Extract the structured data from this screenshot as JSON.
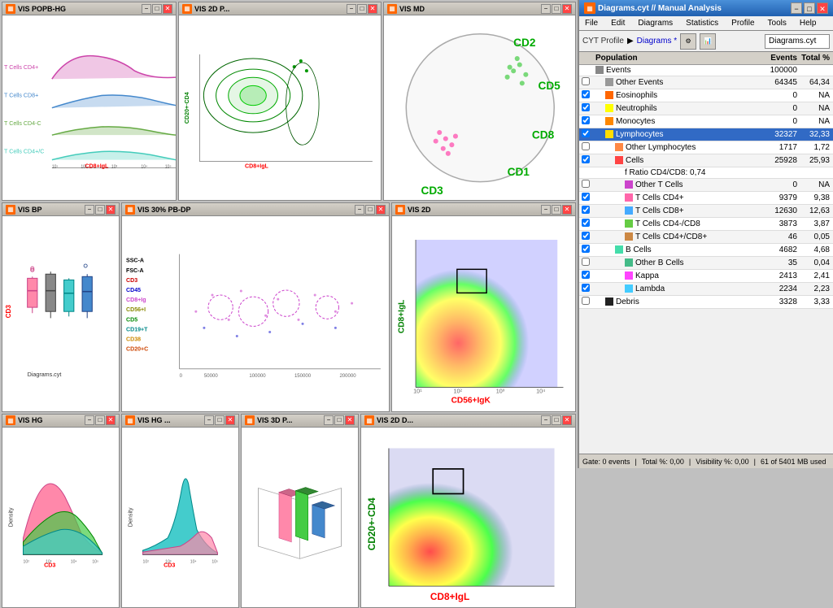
{
  "windows": {
    "top_row": [
      {
        "id": "vis-popb-hg",
        "title": "VIS POPB-HG",
        "icon": "🔬"
      },
      {
        "id": "vis-2dp",
        "title": "VIS 2D P...",
        "icon": "🔬"
      },
      {
        "id": "vis-md",
        "title": "VIS MD",
        "icon": "🔬"
      }
    ],
    "mid_row": [
      {
        "id": "vis-bp",
        "title": "VIS BP",
        "icon": "🔬"
      },
      {
        "id": "vis-30-pb-dp",
        "title": "VIS 30% PB-DP",
        "icon": "🔬"
      },
      {
        "id": "vis-2d",
        "title": "VIS 2D",
        "icon": "🔬"
      }
    ],
    "bot_row": [
      {
        "id": "vis-hg",
        "title": "VIS HG",
        "icon": "🔬"
      },
      {
        "id": "vis-hg2",
        "title": "VIS HG ...",
        "icon": "🔬"
      },
      {
        "id": "vis-3dp",
        "title": "VIS 3D P...",
        "icon": "🔬"
      },
      {
        "id": "vis-2dd",
        "title": "VIS 2D D...",
        "icon": "🔬"
      }
    ]
  },
  "analysis": {
    "title": "Diagrams.cyt // Manual Analysis",
    "menu": [
      "File",
      "Edit",
      "Diagrams",
      "Statistics",
      "Profile",
      "Tools",
      "Help"
    ],
    "toolbar": {
      "label": "CYT Profile",
      "breadcrumb": [
        "Diagrams *"
      ],
      "input_value": "Diagrams.cyt"
    },
    "table": {
      "headers": [
        "Population",
        "Events",
        "Total %"
      ],
      "rows": [
        {
          "indent": 0,
          "checkbox": null,
          "color": "#888888",
          "label": "Events",
          "events": "100000",
          "total": "",
          "highlight": false
        },
        {
          "indent": 1,
          "checkbox": false,
          "color": "#999999",
          "label": "Other Events",
          "events": "64345",
          "total": "64,34",
          "highlight": false
        },
        {
          "indent": 1,
          "checkbox": true,
          "color": "#ff6600",
          "label": "Eosinophils",
          "events": "0",
          "total": "NA",
          "highlight": false
        },
        {
          "indent": 1,
          "checkbox": true,
          "color": "#ffff00",
          "label": "Neutrophils",
          "events": "0",
          "total": "NA",
          "highlight": false
        },
        {
          "indent": 1,
          "checkbox": true,
          "color": "#ff8800",
          "label": "Monocytes",
          "events": "0",
          "total": "NA",
          "highlight": false
        },
        {
          "indent": 1,
          "checkbox": true,
          "color": "#ffdd00",
          "label": "Lymphocytes",
          "events": "32327",
          "total": "32,33",
          "highlight": true
        },
        {
          "indent": 2,
          "checkbox": false,
          "color": "#ff8844",
          "label": "Other Lymphocytes",
          "events": "1717",
          "total": "1,72",
          "highlight": false
        },
        {
          "indent": 2,
          "checkbox": true,
          "color": "#ff4444",
          "label": "Cells",
          "events": "25928",
          "total": "25,93",
          "highlight": false
        },
        {
          "indent": 3,
          "checkbox": null,
          "color": null,
          "label": "f  Ratio CD4/CD8: 0,74",
          "events": "",
          "total": "",
          "highlight": false
        },
        {
          "indent": 3,
          "checkbox": false,
          "color": "#cc44cc",
          "label": "Other T Cells",
          "events": "0",
          "total": "NA",
          "highlight": false
        },
        {
          "indent": 3,
          "checkbox": true,
          "color": "#ff66aa",
          "label": "T Cells CD4+",
          "events": "9379",
          "total": "9,38",
          "highlight": false
        },
        {
          "indent": 3,
          "checkbox": true,
          "color": "#44aaff",
          "label": "T Cells CD8+",
          "events": "12630",
          "total": "12,63",
          "highlight": false
        },
        {
          "indent": 3,
          "checkbox": true,
          "color": "#66cc44",
          "label": "T Cells CD4-/CD8",
          "events": "3873",
          "total": "3,87",
          "highlight": false
        },
        {
          "indent": 3,
          "checkbox": true,
          "color": "#cc8844",
          "label": "T Cells CD4+/CD8+",
          "events": "46",
          "total": "0,05",
          "highlight": false
        },
        {
          "indent": 2,
          "checkbox": true,
          "color": "#44ddaa",
          "label": "B Cells",
          "events": "4682",
          "total": "4,68",
          "highlight": false
        },
        {
          "indent": 3,
          "checkbox": false,
          "color": "#44bb88",
          "label": "Other B Cells",
          "events": "35",
          "total": "0,04",
          "highlight": false
        },
        {
          "indent": 3,
          "checkbox": true,
          "color": "#ff44ff",
          "label": "Kappa",
          "events": "2413",
          "total": "2,41",
          "highlight": false
        },
        {
          "indent": 3,
          "checkbox": true,
          "color": "#44ccff",
          "label": "Lambda",
          "events": "2234",
          "total": "2,23",
          "highlight": false
        },
        {
          "indent": 1,
          "checkbox": false,
          "color": "#222222",
          "label": "Debris",
          "events": "3328",
          "total": "3,33",
          "highlight": false
        }
      ]
    },
    "status_bar": {
      "gate": "Gate: 0 events",
      "total": "Total %: 0,00",
      "visibility": "Visibility %: 0,00",
      "memory": "61 of 5401 MB used"
    }
  },
  "chart_labels": {
    "popb_hg": {
      "y_labels": [
        "T Cells CD4+",
        "T Cells CD8+",
        "T Cells CD4-C",
        "T Cells CD4+/C"
      ],
      "x_label": "CD8+IgL"
    },
    "vis_2dp": {
      "y_label": "CD20+·CD4",
      "x_label": "CD8+IgL"
    },
    "vis_md": {
      "labels": [
        "CD2",
        "CD5",
        "CD8",
        "CD1",
        "CD3"
      ]
    },
    "vis_bp": {
      "y_label": "CD3",
      "sub": "Diagrams.cyt"
    },
    "vis_30_pb_dp": {
      "legend": [
        "SSC-A",
        "FSC-A",
        "CD3",
        "CD45",
        "CD8+Ig",
        "CD56+I",
        "CD5",
        "CD19+T",
        "CD38",
        "CD20+C"
      ]
    },
    "vis_2d_right": {
      "y_label": "CD8+IgL",
      "x_label": "CD56+IgK"
    }
  }
}
